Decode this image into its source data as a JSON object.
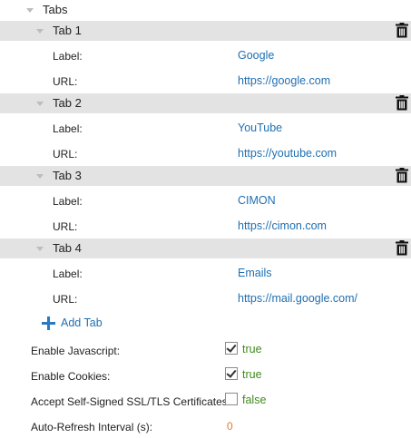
{
  "tabs_section": {
    "title": "Tabs"
  },
  "tabs": [
    {
      "title": "Tab 1",
      "label_key": "Label:",
      "label_value": "Google",
      "url_key": "URL:",
      "url_value": "https://google.com"
    },
    {
      "title": "Tab 2",
      "label_key": "Label:",
      "label_value": "YouTube",
      "url_key": "URL:",
      "url_value": "https://youtube.com"
    },
    {
      "title": "Tab 3",
      "label_key": "Label:",
      "label_value": "CIMON",
      "url_key": "URL:",
      "url_value": "https://cimon.com"
    },
    {
      "title": "Tab 4",
      "label_key": "Label:",
      "label_value": "Emails",
      "url_key": "URL:",
      "url_value": "https://mail.google.com/"
    }
  ],
  "add_tab": {
    "label": "Add Tab"
  },
  "settings": {
    "enable_javascript": {
      "label": "Enable Javascript:",
      "checked": true,
      "value_text": "true"
    },
    "enable_cookies": {
      "label": "Enable Cookies:",
      "checked": true,
      "value_text": "true"
    },
    "accept_self_signed": {
      "label": "Accept Self-Signed SSL/TLS Certificates:",
      "checked": false,
      "value_text": "false"
    },
    "auto_refresh": {
      "label": "Auto-Refresh Interval (s):",
      "value": "0"
    }
  },
  "colors": {
    "link_blue": "#1f6fb2",
    "bool_green": "#3f8a1c",
    "number_orange": "#e07b3a",
    "tab_header_bg": "#e3e3e3"
  }
}
